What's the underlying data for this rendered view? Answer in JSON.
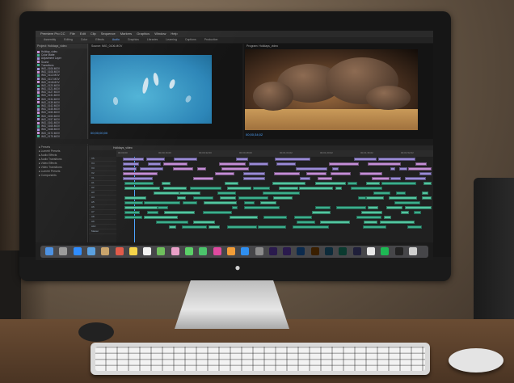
{
  "scene": {
    "description_free": true
  },
  "menubar": {
    "items": [
      "Premiere Pro CC",
      "File",
      "Edit",
      "Clip",
      "Sequence",
      "Markers",
      "Graphics",
      "Window",
      "Help"
    ]
  },
  "workspaces": {
    "items": [
      "Assembly",
      "Editing",
      "Color",
      "Effects",
      "Audio",
      "Graphics",
      "Libraries",
      "Learning",
      "Captions",
      "Production"
    ],
    "active_index": 4
  },
  "project": {
    "tabs": "Project: Holidays_video",
    "items": [
      {
        "name": "Holiday_video",
        "size": ""
      },
      {
        "name": "Color Matte",
        "size": "00;00"
      },
      {
        "name": "Adjustment Layer",
        "size": "00;00"
      },
      {
        "name": "Sound",
        "size": "00;00"
      },
      {
        "name": "Transitions",
        "size": "00;00"
      },
      {
        "name": "IMG_0106.MOV",
        "size": "00;00"
      },
      {
        "name": "IMG_0108.MOV",
        "size": "00;00"
      },
      {
        "name": "IMG_0112.MOV",
        "size": "00;00"
      },
      {
        "name": "IMG_0117.MOV",
        "size": "00;00"
      },
      {
        "name": "IMG_0118.MOV",
        "size": "00;00"
      },
      {
        "name": "IMG_0120.MOV",
        "size": "00;00"
      },
      {
        "name": "IMG_0121.MOV",
        "size": "00;00"
      },
      {
        "name": "IMG_0127.MOV",
        "size": "00;00"
      },
      {
        "name": "IMG_0131.MOV",
        "size": "00;00"
      },
      {
        "name": "IMG_0134.MOV",
        "size": "00;00"
      },
      {
        "name": "IMG_0139.MOV",
        "size": "00;00"
      },
      {
        "name": "IMG_0142.MOV",
        "size": "00;00"
      },
      {
        "name": "IMG_0145.MOV",
        "size": "00;00"
      },
      {
        "name": "IMG_0150.MOV",
        "size": "00;00"
      },
      {
        "name": "IMG_0153.MOV",
        "size": "00;00"
      },
      {
        "name": "IMG_0157.MOV",
        "size": "00;00"
      },
      {
        "name": "IMG_0161.MOV",
        "size": "00;00"
      },
      {
        "name": "IMG_0165.MOV",
        "size": "00;00"
      },
      {
        "name": "IMG_0168.MOV",
        "size": "00;00"
      },
      {
        "name": "IMG_0172.MOV",
        "size": "00;00"
      },
      {
        "name": "IMG_0175.MOV",
        "size": "00;00"
      }
    ]
  },
  "source_monitor": {
    "title": "Source: IMG_0106.MOV",
    "timecode": "00;00;00;00"
  },
  "program_monitor": {
    "title": "Program: Holidays_video",
    "timecode": "00;00;34;02"
  },
  "effects_panel": {
    "items": [
      "Presets",
      "Lumetri Presets",
      "Audio Effects",
      "Audio Transitions",
      "Video Effects",
      "Video Transitions",
      "Lumetri Presets",
      "Components"
    ]
  },
  "timeline": {
    "title": "Holidays_video",
    "ruler": [
      "00;00;00",
      "00;00;16;00",
      "00;00;32;00",
      "00;00;48;00",
      "00;01;04;02",
      "00;01;20;02",
      "00;01;36;02",
      "00;01;52;02"
    ],
    "tracks": [
      "V5",
      "V4",
      "V3",
      "V2",
      "V1",
      "A1",
      "A2",
      "A3",
      "A4",
      "A5",
      "A6",
      "A7",
      "A8",
      "A9",
      "A10",
      "Master"
    ]
  },
  "colors": {
    "video_clip": "#c48ed6",
    "video_clip_alt": "#9a8bd6",
    "audio_clip": "#3cae8c",
    "audio_clip_alt": "#53c6a0",
    "playhead": "#4ea4ff",
    "accent_tape": "#c94a44"
  },
  "dock": {
    "icons": [
      "finder-icon",
      "launchpad-icon",
      "safari-icon",
      "mail-icon",
      "contacts-icon",
      "calendar-icon",
      "notes-icon",
      "reminders-icon",
      "maps-icon",
      "photos-icon",
      "messages-icon",
      "facetime-icon",
      "itunes-icon",
      "ibooks-icon",
      "app-store-icon",
      "system-preferences-icon",
      "premiere-icon",
      "after-effects-icon",
      "photoshop-icon",
      "illustrator-icon",
      "lightroom-icon",
      "audition-icon",
      "media-encoder-icon",
      "chrome-icon",
      "spotify-icon",
      "terminal-icon",
      "trash-icon"
    ]
  }
}
